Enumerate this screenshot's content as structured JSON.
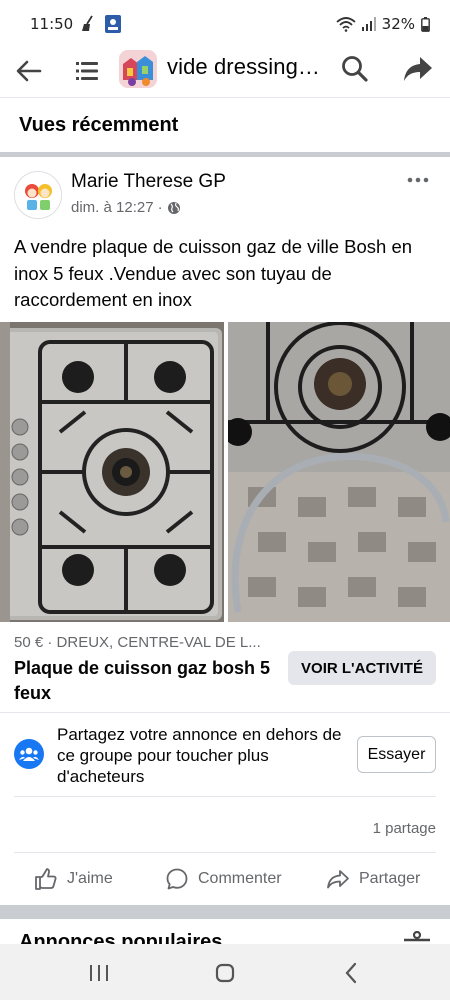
{
  "status_bar": {
    "time": "11:50",
    "battery": "32%"
  },
  "header": {
    "group_title": "vide dressing…"
  },
  "recent": {
    "title": "Vues récemment"
  },
  "post": {
    "author": "Marie Therese GP",
    "timestamp": "dim. à 12:27",
    "separator": "·",
    "text": "A vendre plaque de cuisson  gaz de ville Bosh en inox 5 feux .Vendue avec son tuyau de raccordement en inox",
    "listing": {
      "price_location": "50 € · DREUX, CENTRE-VAL DE L...",
      "title": "Plaque de cuisson gaz bosh 5 feux",
      "activity_button": "VOIR L'ACTIVITÉ"
    },
    "promo": {
      "text": "Partagez votre annonce en dehors de ce groupe pour toucher plus d'acheteurs",
      "button": "Essayer"
    },
    "share_count": "1 partage",
    "actions": {
      "like": "J'aime",
      "comment": "Commenter",
      "share": "Partager"
    }
  },
  "popular": {
    "title": "Annonces populaires"
  },
  "colors": {
    "text_primary": "#050505",
    "text_secondary": "#65676b",
    "divider": "#e4e6eb",
    "section_gap": "#c9ccd1",
    "accent": "#1877f2",
    "button_bg": "#e4e6eb"
  },
  "icons": {
    "status_left": [
      "broom-icon",
      "id-card-icon"
    ],
    "status_right": [
      "wifi-icon",
      "signal-icon",
      "battery-icon"
    ],
    "header": [
      "back-arrow-icon",
      "menu-icon",
      "group-avatar",
      "search-icon",
      "share-arrow-icon"
    ],
    "post": [
      "more-options-icon",
      "globe-icon",
      "group-members-icon",
      "like-icon",
      "comment-icon",
      "share-icon",
      "filter-icon"
    ],
    "nav": [
      "recent-apps-icon",
      "home-icon",
      "back-icon"
    ]
  }
}
